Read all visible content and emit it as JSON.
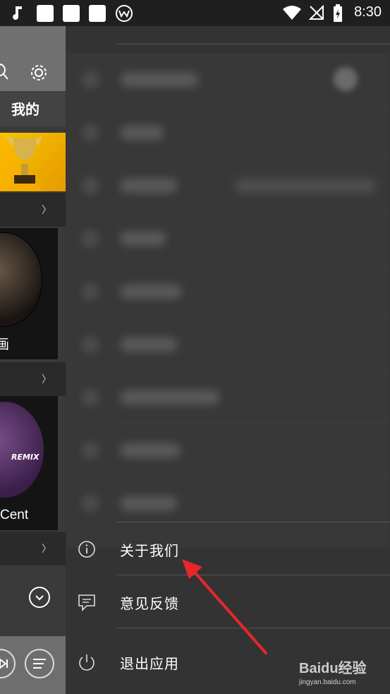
{
  "status_bar": {
    "time": "8:30"
  },
  "left_page": {
    "tab_label": "我的",
    "card2_text": "Cent",
    "card2_disc_text": "REMIX"
  },
  "drawer": {
    "menu": [
      {
        "label": "关于我们",
        "icon": "info-icon"
      },
      {
        "label": "意见反馈",
        "icon": "message-icon"
      },
      {
        "label": "退出应用",
        "icon": "power-icon"
      }
    ]
  },
  "annotation": {
    "arrow_color": "#e8262c"
  },
  "watermark": {
    "brand": "Baidu经验",
    "url": "jingyan.baidu.com"
  }
}
